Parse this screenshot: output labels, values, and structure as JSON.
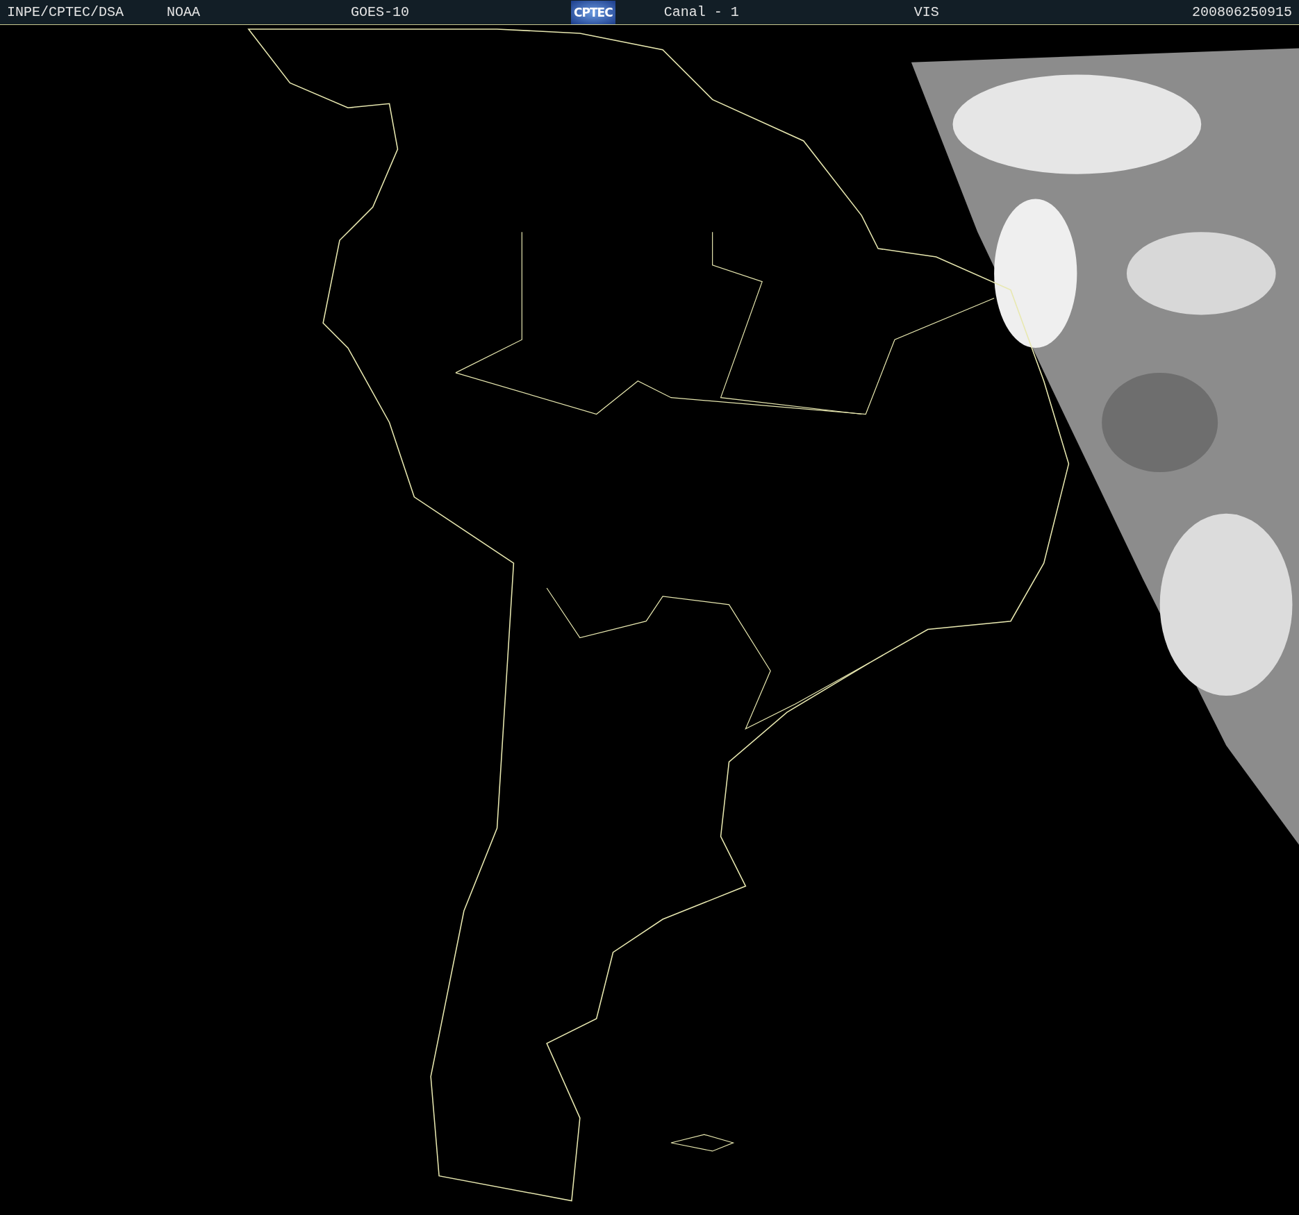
{
  "header": {
    "items": [
      {
        "kind": "text",
        "text": "INPE/CPTEC/DSA"
      },
      {
        "kind": "text",
        "text": "NOAA"
      },
      {
        "kind": "text",
        "text": "GOES-10"
      },
      {
        "kind": "logo",
        "text": "CPTEC"
      },
      {
        "kind": "text",
        "text": "Canal - 1"
      },
      {
        "kind": "text",
        "text": "VIS"
      },
      {
        "kind": "text",
        "text": "200806250915"
      }
    ]
  }
}
